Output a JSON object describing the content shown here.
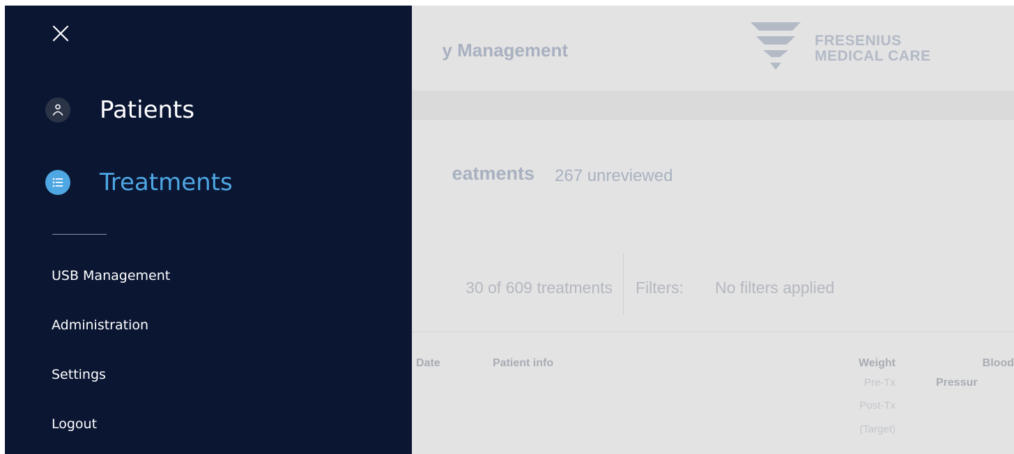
{
  "app": {
    "title": "y Management",
    "logo": {
      "line1": "FRESENIUS",
      "line2": "MEDICAL CARE"
    }
  },
  "page": {
    "title": "eatments",
    "unreviewed": "267 unreviewed",
    "count_text": "30 of 609 treatments",
    "filters_label": "Filters:",
    "filters_value": "No filters applied"
  },
  "table": {
    "headers": {
      "date": "Date",
      "patient_info": "Patient info",
      "weight": "Weight",
      "weight_sub": [
        "Pre-Tx",
        "Post-Tx",
        "(Target)"
      ],
      "blood_pressure_line1": "Blood",
      "blood_pressure_line2": "Pressur"
    }
  },
  "nav": {
    "close_icon": "close-icon",
    "main": [
      {
        "label": "Patients",
        "icon": "person-icon",
        "active": false
      },
      {
        "label": "Treatments",
        "icon": "list-icon",
        "active": true
      }
    ],
    "secondary": [
      "USB Management",
      "Administration",
      "Settings",
      "Logout"
    ]
  },
  "colors": {
    "drawer_bg": "#0b1633",
    "accent": "#4ea7e3",
    "overlay_bg": "#e3e3e3"
  }
}
